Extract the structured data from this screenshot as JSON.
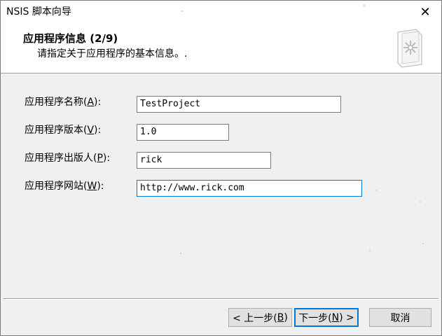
{
  "window": {
    "title": "NSIS 脚本向导",
    "close_glyph": "✕"
  },
  "header": {
    "title": "应用程序信息 (2/9)",
    "subtitle": "请指定关于应用程序的基本信息。.",
    "logo_icon": "nsis-logo-icon"
  },
  "form": {
    "name": {
      "label_prefix": "应用程序名称(",
      "accel": "A",
      "label_suffix": "):",
      "value": "TestProject"
    },
    "version": {
      "label_prefix": "应用程序版本(",
      "accel": "V",
      "label_suffix": "):",
      "value": "1.0"
    },
    "publisher": {
      "label_prefix": "应用程序出版人(",
      "accel": "P",
      "label_suffix": "):",
      "value": "rick"
    },
    "website": {
      "label_prefix": "应用程序网站(",
      "accel": "W",
      "label_suffix": "):",
      "value": "http://www.rick.com"
    }
  },
  "buttons": {
    "back": {
      "label_prefix": "< 上一步(",
      "accel": "B",
      "label_suffix": ")"
    },
    "next": {
      "label_prefix": "下一步(",
      "accel": "N",
      "label_suffix": ") >"
    },
    "cancel": {
      "label": "取消"
    }
  }
}
